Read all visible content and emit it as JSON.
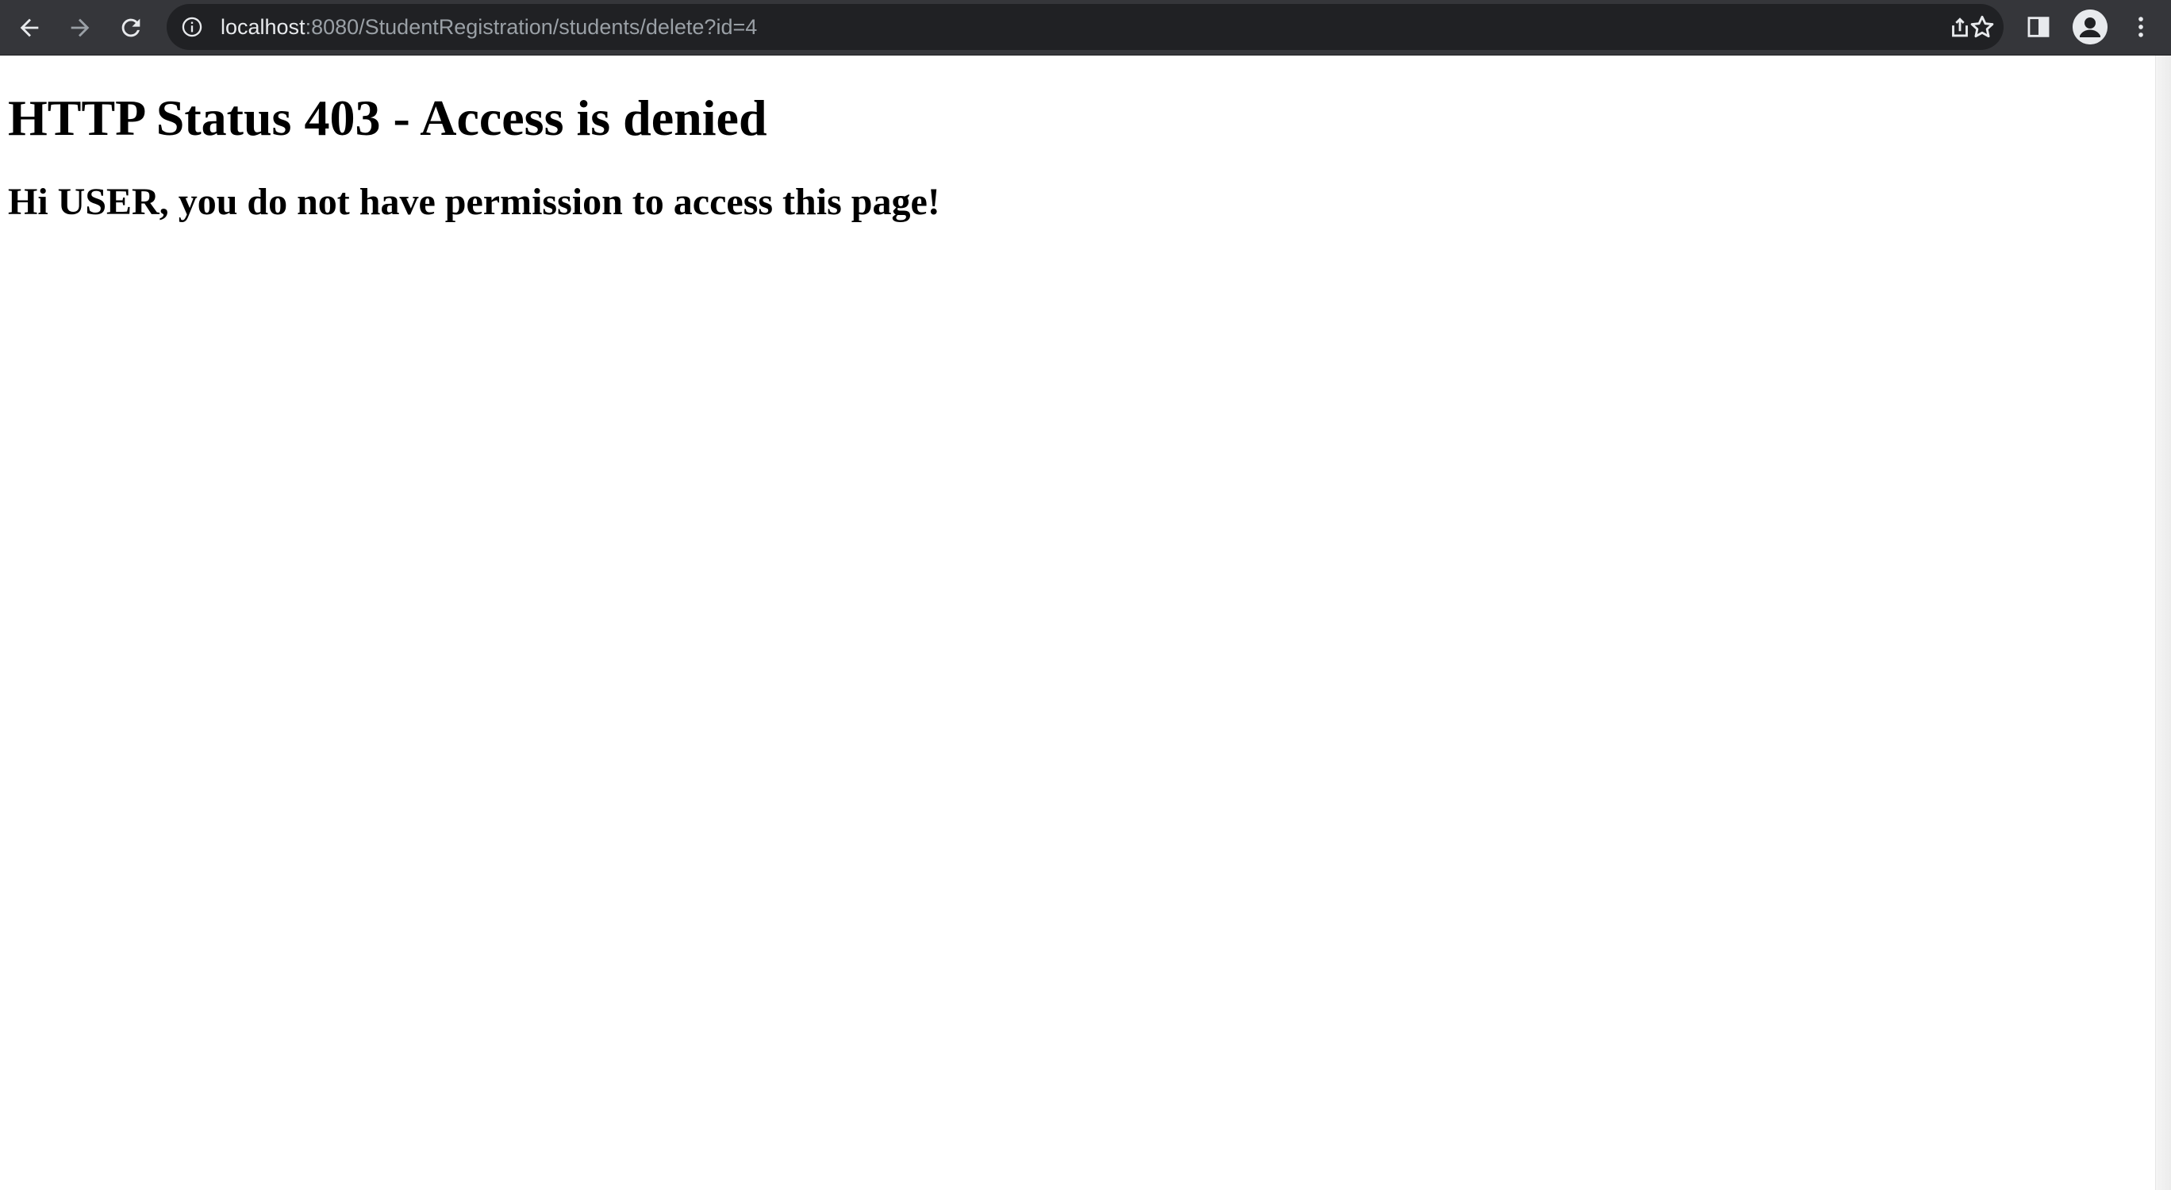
{
  "browser": {
    "url_host": "localhost",
    "url_rest": ":8080/StudentRegistration/students/delete?id=4",
    "icons": {
      "back": "arrow-left-icon",
      "forward": "arrow-right-icon",
      "reload": "reload-icon",
      "site_info": "info-icon",
      "share": "share-icon",
      "bookmark": "star-icon",
      "side_panel": "side-panel-icon",
      "profile": "avatar-icon",
      "menu": "kebab-menu-icon"
    },
    "colors": {
      "toolbar": "#35363a",
      "omnibox": "#202124",
      "icon": "#e8eaed",
      "disabled_icon": "#9aa0a6"
    }
  },
  "page": {
    "heading": "HTTP Status 403 - Access is denied",
    "message": "Hi USER, you do not have permission to access this page!"
  }
}
